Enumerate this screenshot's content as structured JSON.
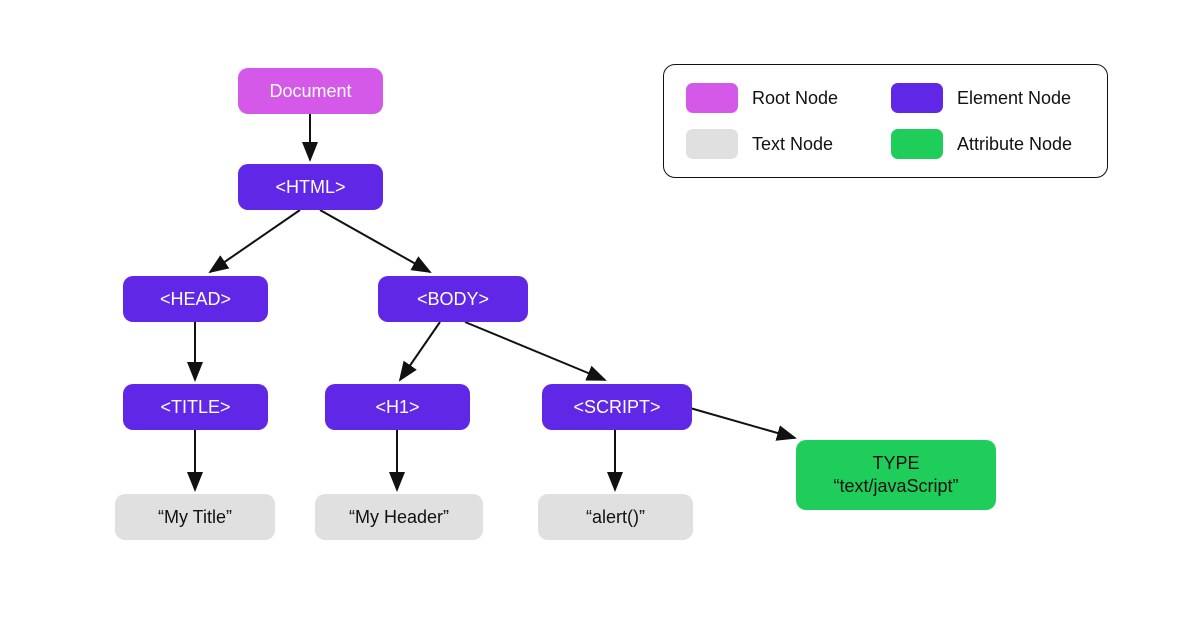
{
  "colors": {
    "root": "#d459e8",
    "element": "#6028e6",
    "text": "#e0e0e0",
    "attribute": "#1fce5a"
  },
  "legend": {
    "root": "Root Node",
    "element": "Element Node",
    "text": "Text Node",
    "attribute": "Attribute Node"
  },
  "nodes": {
    "document": "Document",
    "html": "<HTML>",
    "head": "<HEAD>",
    "body": "<BODY>",
    "title": "<TITLE>",
    "h1": "<H1>",
    "script": "<SCRIPT>",
    "title_text": "“My Title”",
    "h1_text": "“My Header”",
    "script_text": "“alert()”",
    "attr_line1": "TYPE",
    "attr_line2": "“text/javaScript”"
  },
  "tree": {
    "type": "dom-tree-diagram",
    "edges": [
      [
        "Document",
        "<HTML>"
      ],
      [
        "<HTML>",
        "<HEAD>"
      ],
      [
        "<HTML>",
        "<BODY>"
      ],
      [
        "<HEAD>",
        "<TITLE>"
      ],
      [
        "<BODY>",
        "<H1>"
      ],
      [
        "<BODY>",
        "<SCRIPT>"
      ],
      [
        "<TITLE>",
        "\"My Title\""
      ],
      [
        "<H1>",
        "\"My Header\""
      ],
      [
        "<SCRIPT>",
        "\"alert()\""
      ],
      [
        "<SCRIPT>",
        "TYPE \"text/javaScript\""
      ]
    ]
  }
}
